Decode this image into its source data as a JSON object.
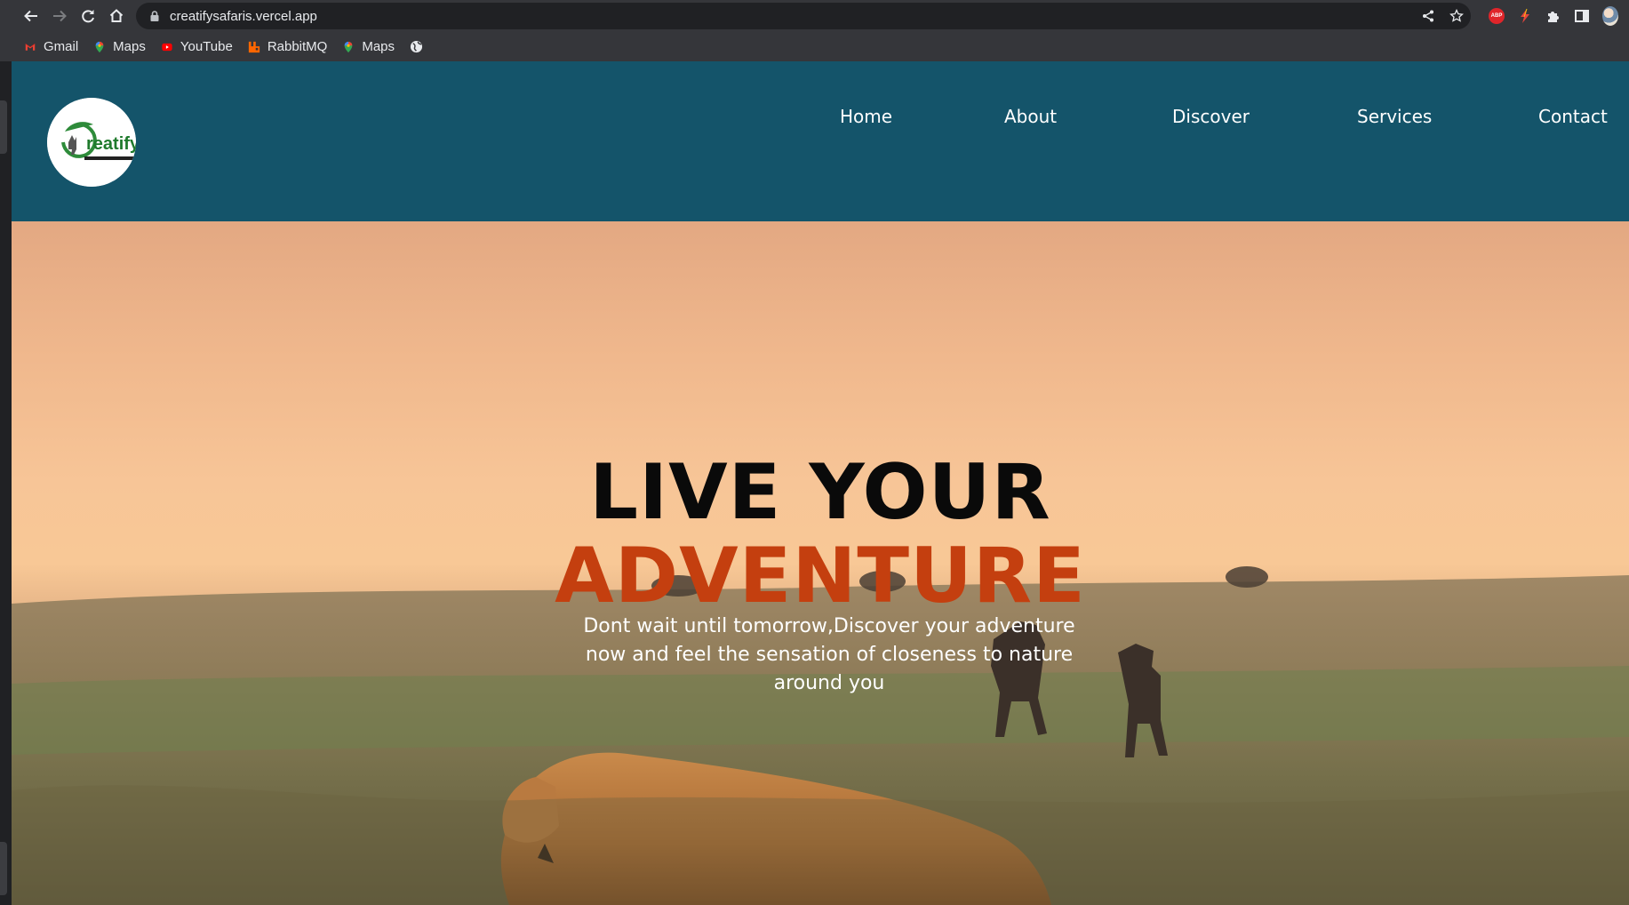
{
  "browser": {
    "url": "creatifysafaris.vercel.app",
    "bookmarks": [
      {
        "label": "Gmail",
        "icon": "gmail-icon"
      },
      {
        "label": "Maps",
        "icon": "maps-icon"
      },
      {
        "label": "YouTube",
        "icon": "youtube-icon"
      },
      {
        "label": "RabbitMQ",
        "icon": "rabbitmq-icon"
      },
      {
        "label": "Maps",
        "icon": "maps-icon"
      },
      {
        "label": "",
        "icon": "globe-icon"
      }
    ],
    "extensions": {
      "abp_label": "ABP"
    }
  },
  "site": {
    "logo_text": "reatify",
    "nav": [
      "Home",
      "About",
      "Discover",
      "Services",
      "Contact"
    ],
    "hero": {
      "title_line1": "LIVE YOUR",
      "title_line2": "ADVENTURE",
      "subtitle": "Dont wait until tomorrow,Discover your adventure now and feel the sensation of closeness to nature around you"
    },
    "colors": {
      "header_bg": "#14546a",
      "title_accent": "#c43f0f",
      "title_dark": "#0a0a0a"
    }
  }
}
